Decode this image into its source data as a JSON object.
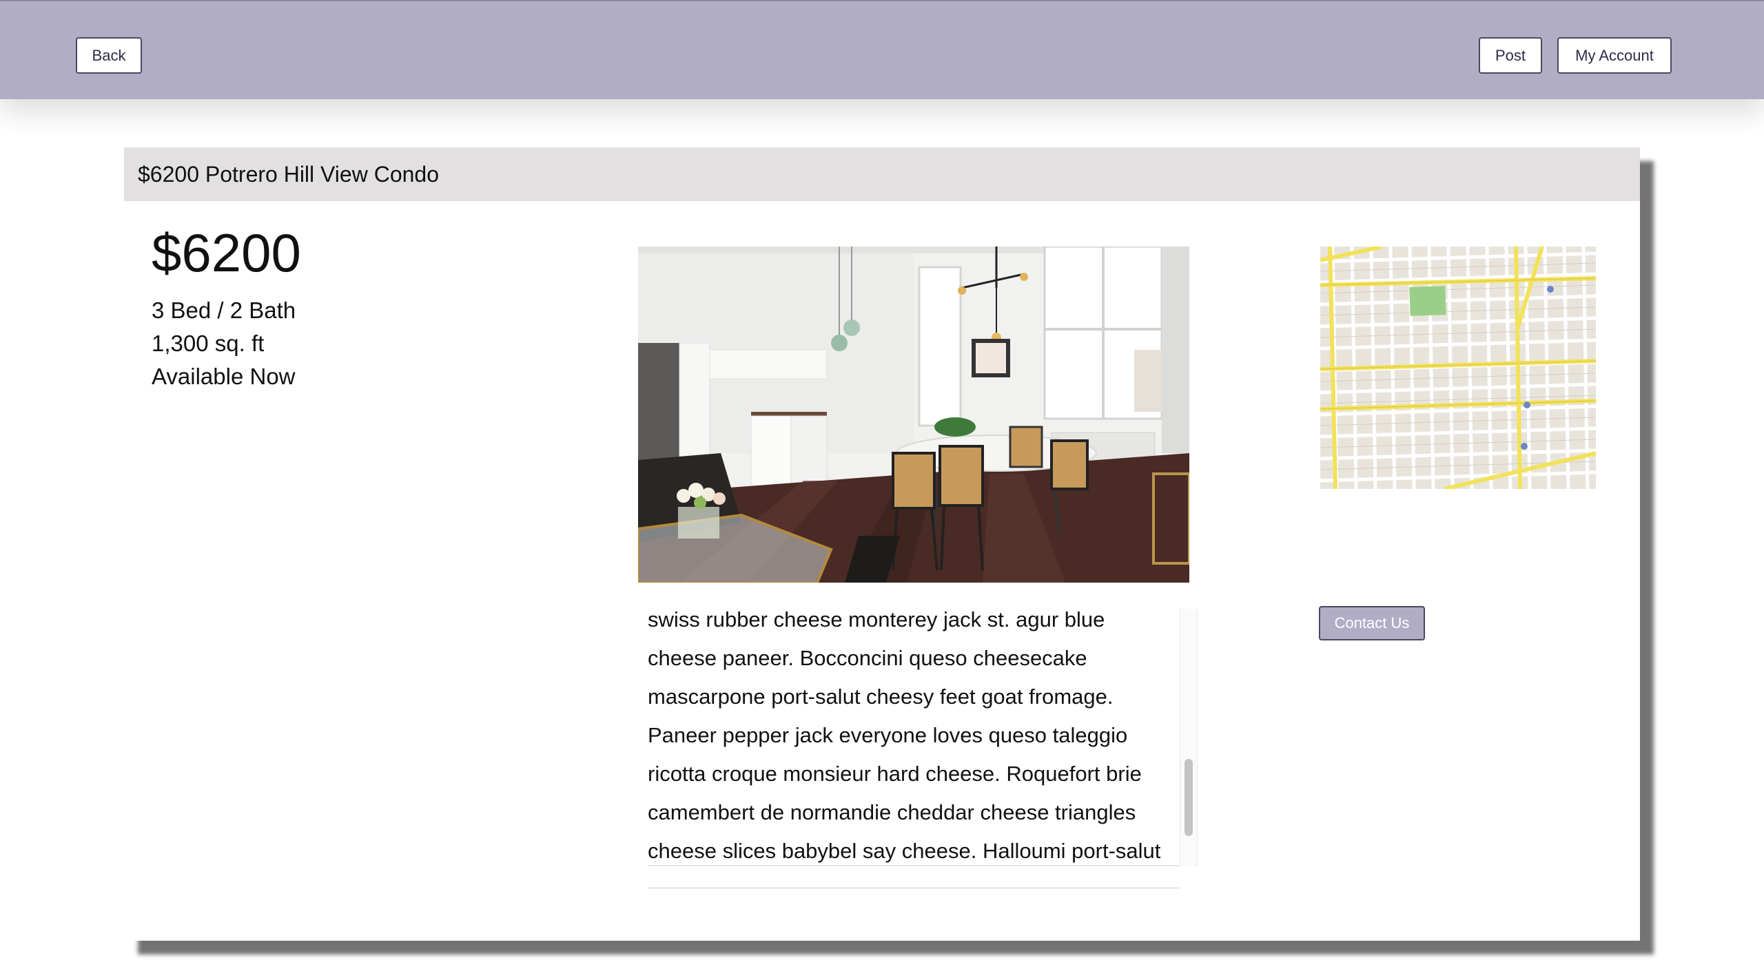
{
  "nav": {
    "back_label": "Back",
    "post_label": "Post",
    "account_label": "My Account"
  },
  "listing": {
    "title": "$6200 Potrero Hill View Condo",
    "price": "$6200",
    "beds_baths": "3 Bed / 2 Bath",
    "area": "1,300 sq. ft",
    "availability": "Available Now",
    "description": "swiss rubber cheese monterey jack st. agur blue cheese paneer. Bocconcini queso cheesecake mascarpone port-salut cheesy feet goat fromage. Paneer pepper jack everyone loves queso taleggio ricotta croque monsieur hard cheese. Roquefort brie camembert de normandie cheddar cheese triangles cheese slices babybel say cheese. Halloumi port-salut fromage frais red leicester",
    "contact_label": "Contact Us"
  },
  "icons": {
    "photo": "listing-photo",
    "map": "map-thumbnail"
  },
  "colors": {
    "accent": "#b0adc5",
    "header_bg": "#e2e0e0",
    "button_border": "#4a4860",
    "map_road": "#f2e25a",
    "map_park": "#9bcf88"
  }
}
